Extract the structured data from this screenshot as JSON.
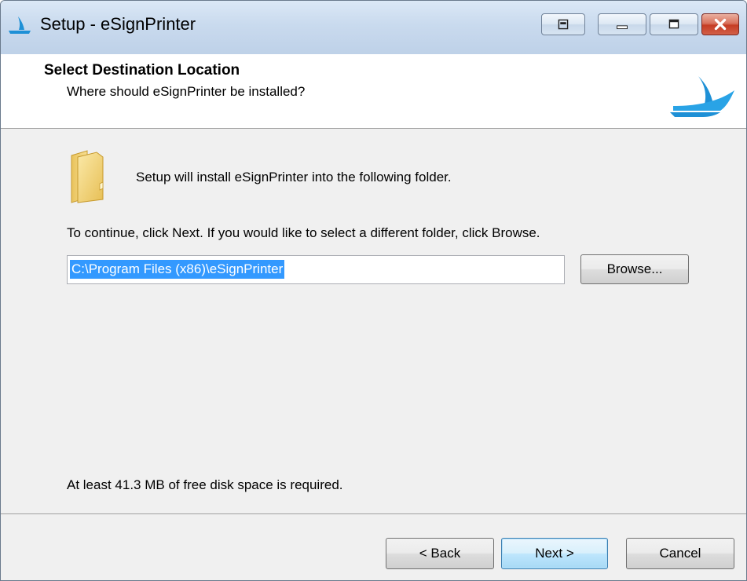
{
  "window": {
    "title": "Setup - eSignPrinter"
  },
  "header": {
    "title": "Select Destination Location",
    "subtitle": "Where should eSignPrinter be installed?",
    "logo_icon": "esignprinter-logo-icon"
  },
  "content": {
    "folder_icon": "folder-icon",
    "intro": "Setup will install eSignPrinter into the following folder.",
    "instruction": "To continue, click Next. If you would like to select a different folder, click Browse.",
    "path_value": "C:\\Program Files (x86)\\eSignPrinter",
    "browse_label": "Browse...",
    "disk_space": "At least 41.3 MB of free disk space is required."
  },
  "footer": {
    "back_label": "< Back",
    "next_label": "Next >",
    "cancel_label": "Cancel"
  },
  "colors": {
    "accent": "#1e90d6",
    "selection": "#3399ff",
    "close_button": "#c53d24"
  }
}
